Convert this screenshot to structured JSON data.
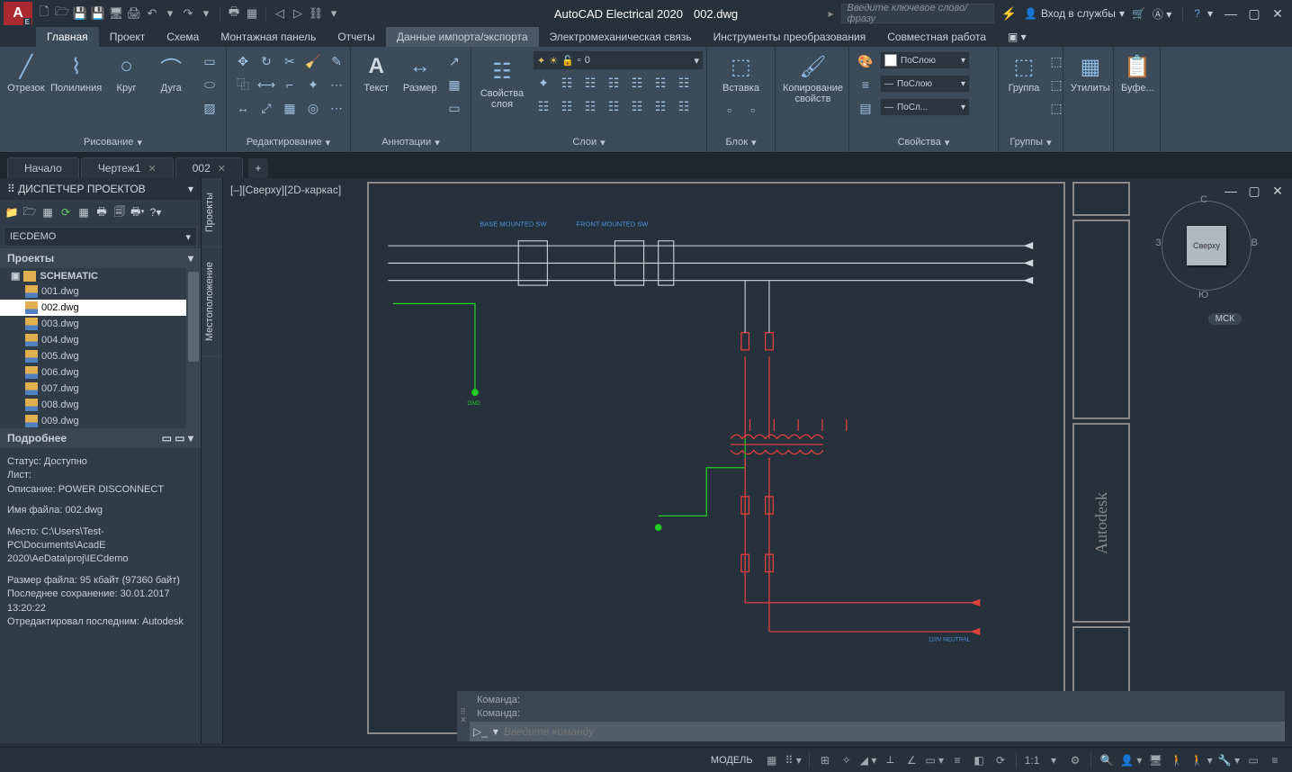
{
  "title": {
    "app": "AutoCAD Electrical 2020",
    "doc": "002.dwg"
  },
  "search_placeholder": "Введите ключевое слово/фразу",
  "signin": "Вход в службы",
  "menutabs": [
    "Главная",
    "Проект",
    "Схема",
    "Монтажная панель",
    "Отчеты",
    "Данные импорта/экспорта",
    "Электромеханическая связь",
    "Инструменты преобразования",
    "Совместная работа"
  ],
  "ribbon": {
    "draw": {
      "title": "Рисование",
      "items": [
        "Отрезок",
        "Полилиния",
        "Круг",
        "Дуга"
      ]
    },
    "edit": {
      "title": "Редактирование"
    },
    "annot": {
      "title": "Аннотации",
      "items": [
        "Текст",
        "Размер"
      ]
    },
    "layers": {
      "title": "Слои",
      "combo_value": "0",
      "big": "Свойства слоя"
    },
    "block": {
      "title": "Блок",
      "big": "Вставка"
    },
    "copyprops": {
      "big": "Копирование свойств"
    },
    "props": {
      "title": "Свойства",
      "bylayer": "ПоСлою",
      "bylayer2": "ПоСлою",
      "bylayer3": "ПоСл..."
    },
    "groups": {
      "title": "Группы",
      "big": "Группа"
    },
    "util": {
      "big": "Утилиты"
    },
    "clip": {
      "big": "Буфе..."
    }
  },
  "filetabs": [
    {
      "label": "Начало",
      "active": false,
      "closable": false
    },
    {
      "label": "Чертеж1",
      "active": false,
      "closable": true
    },
    {
      "label": "002",
      "active": true,
      "closable": true
    }
  ],
  "pm": {
    "title": "ДИСПЕТЧЕР ПРОЕКТОВ",
    "project": "IECDEMO",
    "section": "Проекты",
    "folder": "SCHEMATIC",
    "files": [
      "001.dwg",
      "002.dwg",
      "003.dwg",
      "004.dwg",
      "005.dwg",
      "006.dwg",
      "007.dwg",
      "008.dwg",
      "009.dwg"
    ],
    "selected": "002.dwg",
    "details_hdr": "Подробнее",
    "status": "Статус: Доступно",
    "sheet": "Лист:",
    "desc": "Описание: POWER DISCONNECT",
    "filename": "Имя файла: 002.dwg",
    "location": "Место: C:\\Users\\Test-PC\\Documents\\AcadE 2020\\AeData\\proj\\IECdemo",
    "size": "Размер файла: 95 кбайт (97360 байт)",
    "saved": "Последнее сохранение: 30.01.2017 13:20:22",
    "editor": "Отредактировал последним: Autodesk"
  },
  "vtabs": [
    "Проекты",
    "Местоположение"
  ],
  "viewport_label": "[–][Сверху][2D-каркас]",
  "viewcube": {
    "face": "Сверху",
    "n": "С",
    "s": "Ю",
    "e": "В",
    "w": "З"
  },
  "ucs": "МСК",
  "cmd": {
    "hist1": "Команда:",
    "hist2": "Команда:",
    "placeholder": "Введите команду"
  },
  "status": {
    "model": "МОДЕЛЬ",
    "scale": "1:1"
  },
  "schematic": {
    "labels": {
      "sw1": "BASE MOUNTED SW",
      "sw2": "FRONT MOUNTED SW",
      "neutral": "110V NEUTRAL",
      "gnd": "GND"
    }
  }
}
